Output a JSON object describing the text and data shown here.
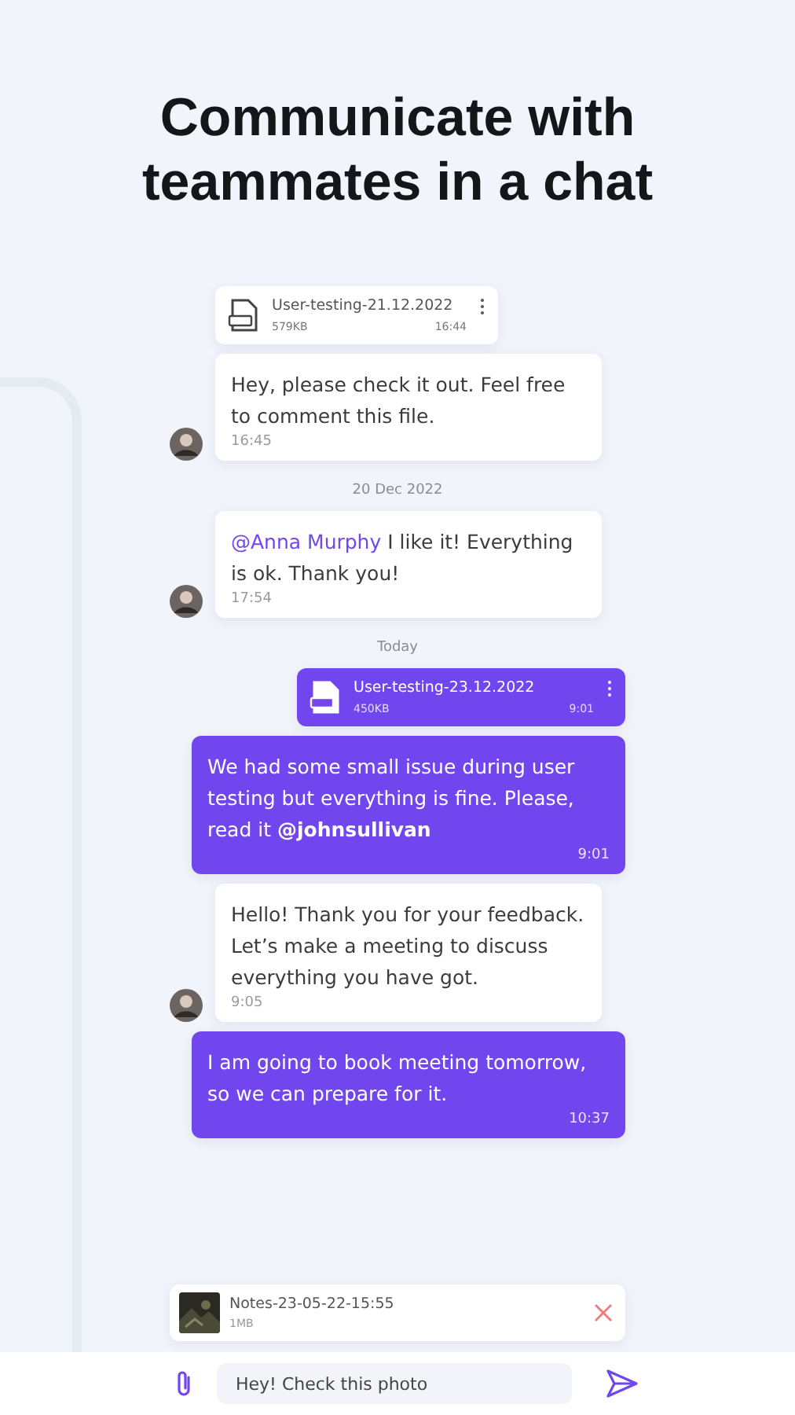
{
  "headline": "Communicate with teammates in a chat",
  "messages": [
    {
      "kind": "file",
      "outgoing": false,
      "name": "User-testing-21.12.2022",
      "size": "579KB",
      "time": "16:44",
      "avatar": false
    },
    {
      "kind": "text",
      "outgoing": false,
      "text": "Hey, please check it out. Feel free to comment this file.",
      "time": "16:45",
      "avatar": true
    },
    {
      "kind": "date",
      "text": "20 Dec 2022"
    },
    {
      "kind": "text",
      "outgoing": false,
      "mention": "@Anna Murphy",
      "text": "I like it! Everything is ok. Thank you!",
      "time": "17:54",
      "avatar": true
    },
    {
      "kind": "date",
      "text": "Today"
    },
    {
      "kind": "file",
      "outgoing": true,
      "name": "User-testing-23.12.2022",
      "size": "450KB",
      "time": "9:01"
    },
    {
      "kind": "text",
      "outgoing": true,
      "text": "We had some small issue during user testing but everything is fine. Please, read it **@johnsullivan**",
      "time": "9:01"
    },
    {
      "kind": "text",
      "outgoing": false,
      "text": "Hello! Thank you for your feedback. Let’s make a meeting to discuss everything you have got.",
      "time": "9:05",
      "avatar": true
    },
    {
      "kind": "text",
      "outgoing": true,
      "text": "I am going to book meeting tomorrow, so we can prepare for it.",
      "time": "10:37"
    }
  ],
  "attachment": {
    "name": "Notes-23-05-22-15:55",
    "size": "1MB"
  },
  "composer": {
    "value": "Hey! Check this photo"
  }
}
